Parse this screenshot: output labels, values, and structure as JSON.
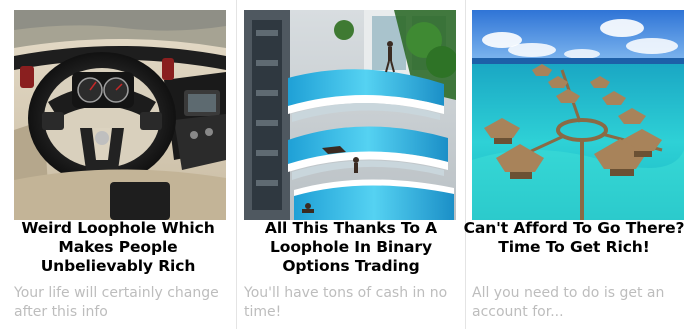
{
  "ads": [
    {
      "image": "car-interior-image",
      "headline": "Weird Loophole Which Makes People Unbelievably Rich",
      "teaser": "Your life will certainly change after this info"
    },
    {
      "image": "balcony-pools-image",
      "headline": "All This Thanks To A Loophole In Binary Options Trading",
      "teaser": "You'll have tons of cash in no time!"
    },
    {
      "image": "overwater-bungalows-image",
      "headline": "Can't Afford To Go There? Time To Get Rich!",
      "teaser": "All you need to do is get an account for..."
    }
  ],
  "colors": {
    "headline": "#000000",
    "teaser": "#bdbdbd",
    "divider": "#e4e4e4"
  }
}
